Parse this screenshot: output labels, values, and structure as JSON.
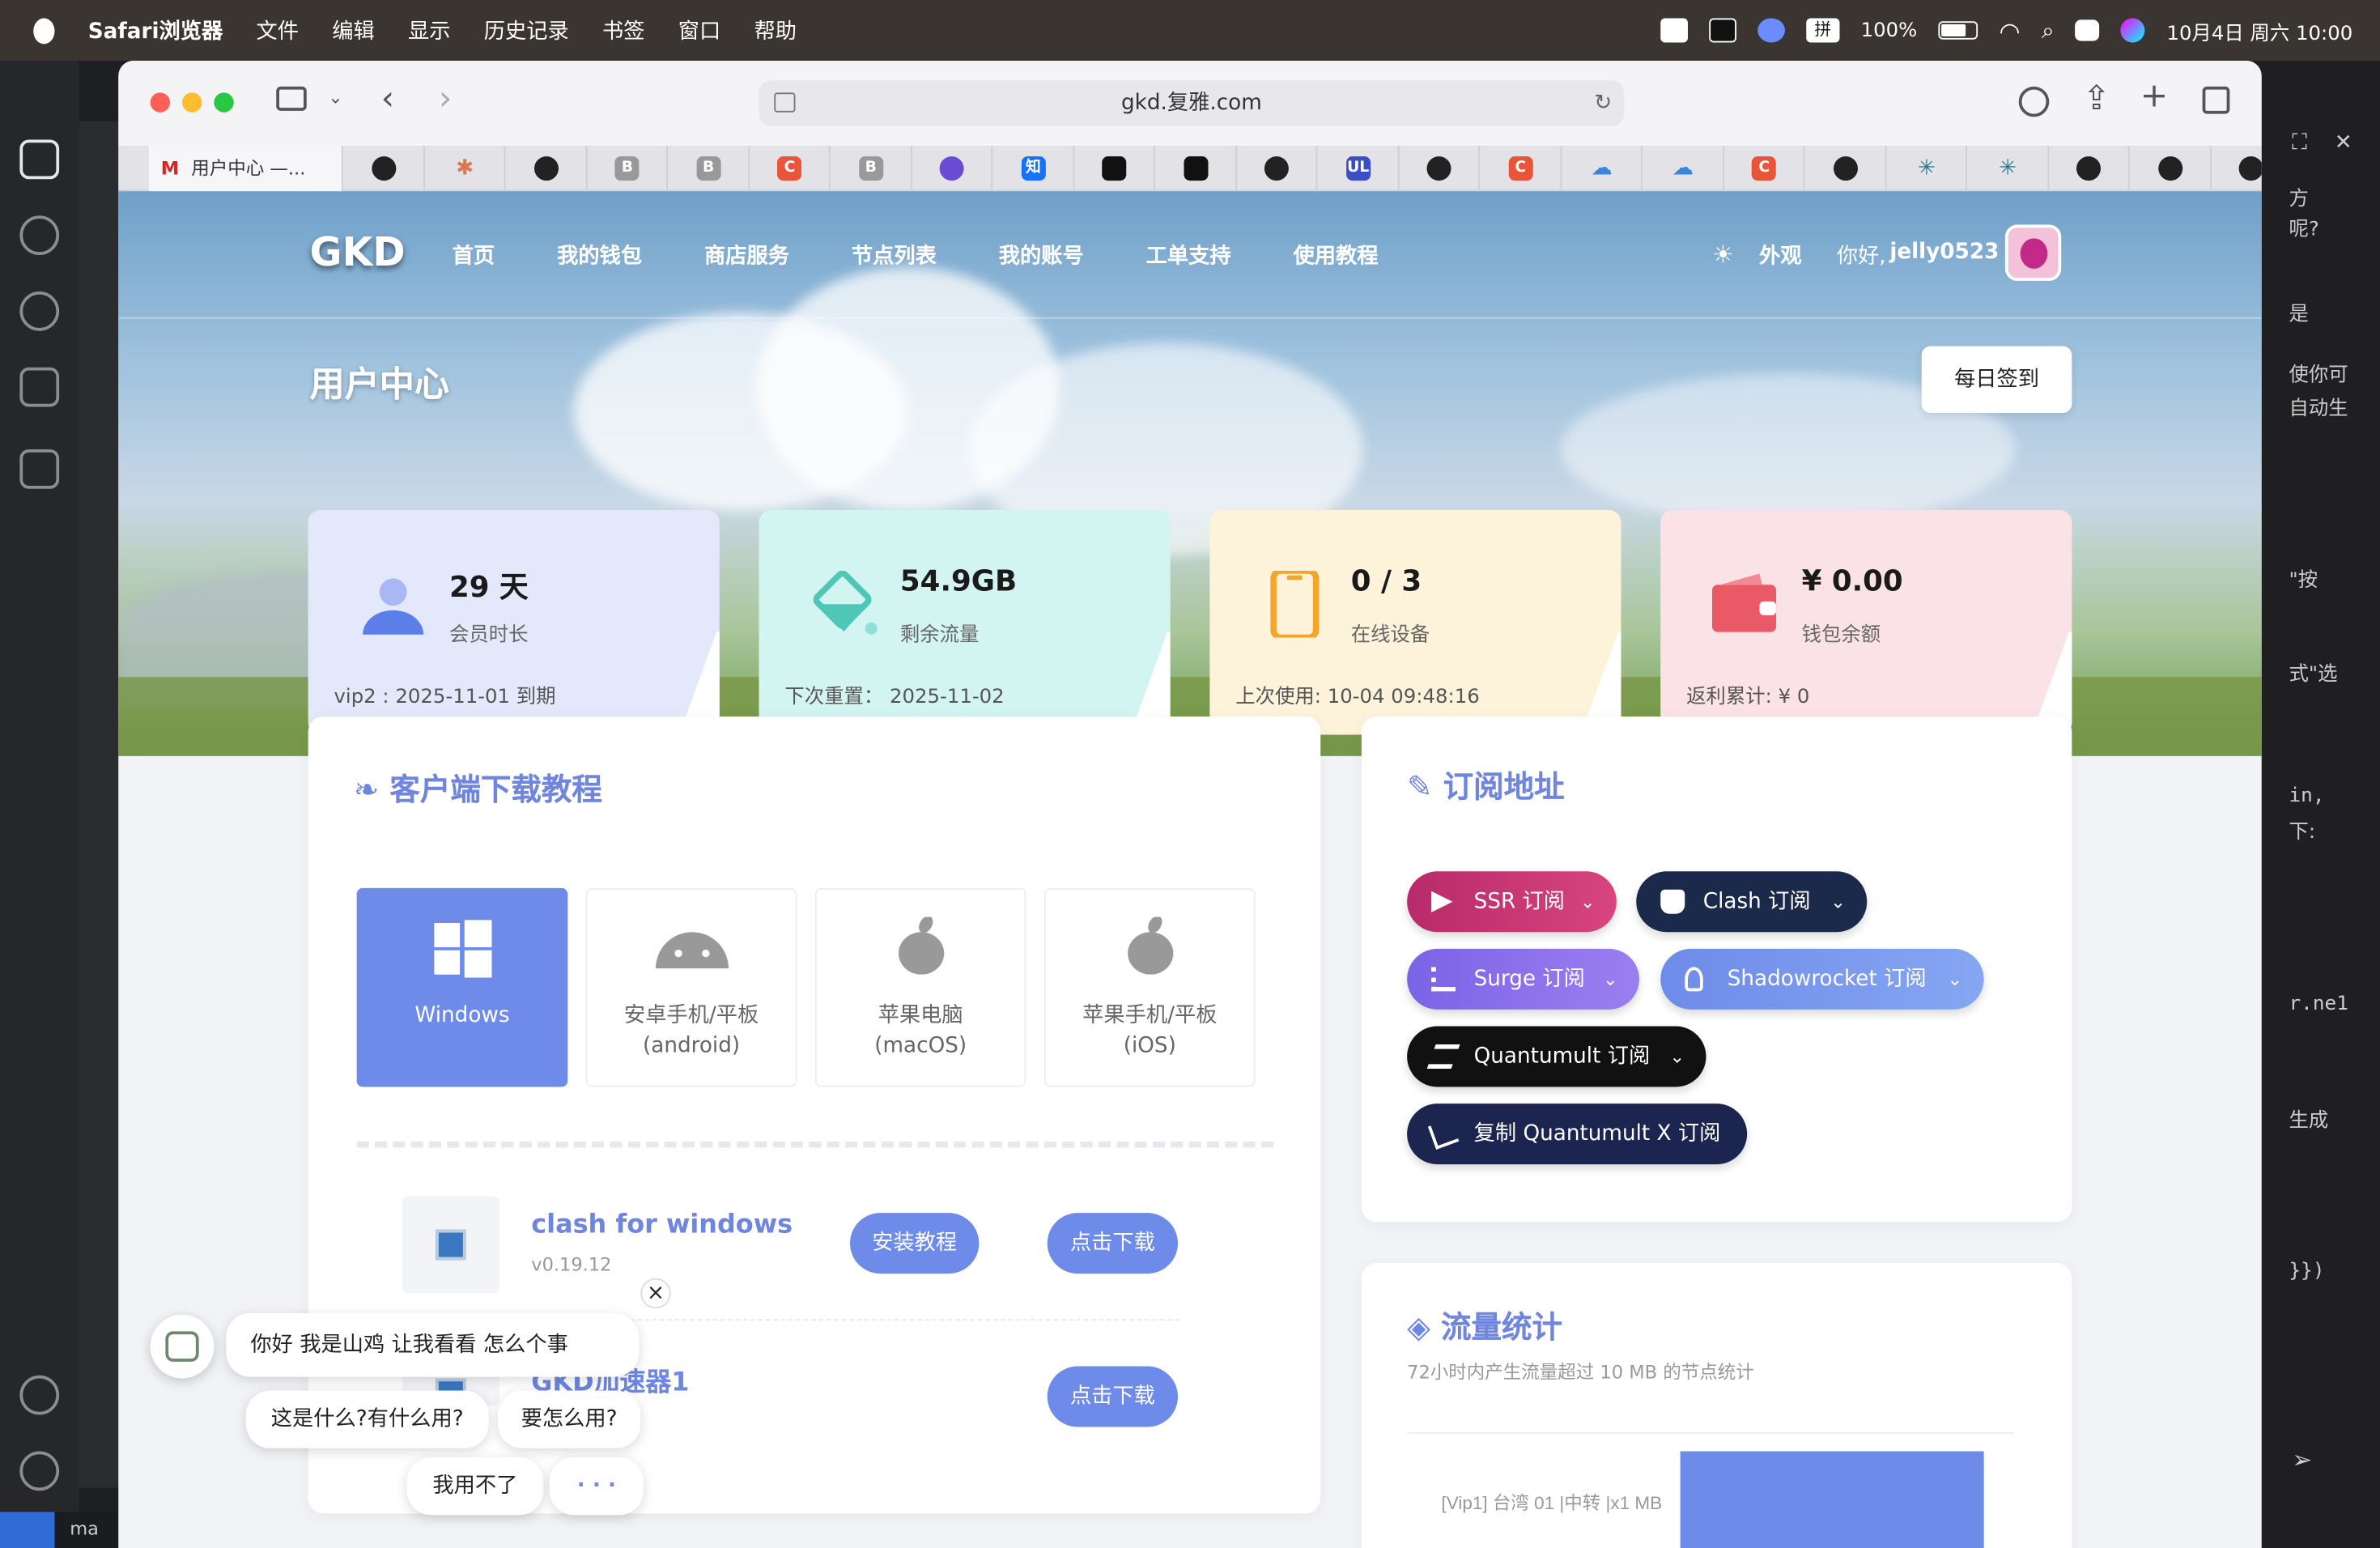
{
  "menubar": {
    "app": "Safari浏览器",
    "items": [
      "文件",
      "编辑",
      "显示",
      "历史记录",
      "书签",
      "窗口",
      "帮助"
    ],
    "input_badge": "拼",
    "battery": "100%",
    "datetime": "10月4日 周六 10:00"
  },
  "background_app": {
    "right_texts": [
      "方",
      "呢?",
      "是",
      "使你可",
      "自动生",
      "\"按",
      "式\"选",
      "in,",
      "下:",
      "r.ne1",
      "生成",
      "}})"
    ],
    "status_text": "ma"
  },
  "browser": {
    "url": "gkd.复雅.com",
    "active_tab": "用户中心 —...",
    "tab_favicons": [
      "github",
      "claude",
      "github",
      "B",
      "B",
      "C",
      "B",
      "github-purple",
      "知",
      "notion",
      "notion",
      "github",
      "UL",
      "github",
      "C",
      "cloud",
      "cloud",
      "C",
      "github",
      "perplexity",
      "perplexity",
      "github",
      "github",
      "github"
    ]
  },
  "nav": {
    "logo": "GKD",
    "items": [
      "首页",
      "我的钱包",
      "商店服务",
      "节点列表",
      "我的账号",
      "工单支持",
      "使用教程"
    ],
    "appearance": "外观",
    "greeting_prefix": "你好,",
    "username": "jelly0523"
  },
  "page": {
    "title": "用户中心",
    "checkin_button": "每日签到"
  },
  "stats": [
    {
      "value": "29 天",
      "label": "会员时长",
      "foot": "vip2 : 2025-11-01 到期",
      "color": "#e3e8fb"
    },
    {
      "value": "54.9GB",
      "label": "剩余流量",
      "foot": "下次重置： 2025-11-02",
      "color": "#d3f5f1"
    },
    {
      "value": "0 / 3",
      "label": "在线设备",
      "foot": "上次使用: 10-04 09:48:16",
      "color": "#fdf3da"
    },
    {
      "value": "¥ 0.00",
      "label": "钱包余额",
      "foot": "返利累计: ¥ 0",
      "color": "#fbe2e6"
    }
  ],
  "download": {
    "title": "客户端下载教程",
    "os_tabs": [
      {
        "line1": "Windows",
        "line2": "",
        "icon": "windows-icon",
        "selected": true
      },
      {
        "line1": "安卓手机/平板",
        "line2": "(android)",
        "icon": "android-icon",
        "selected": false
      },
      {
        "line1": "苹果电脑",
        "line2": "(macOS)",
        "icon": "apple-icon",
        "selected": false
      },
      {
        "line1": "苹果手机/平板",
        "line2": "(iOS)",
        "icon": "apple-icon",
        "selected": false
      }
    ],
    "apps": [
      {
        "name": "clash for windows",
        "version": "v0.19.12",
        "tutorial": "安装教程",
        "download": "点击下载"
      },
      {
        "name": "GKD加速器1",
        "version": "",
        "tutorial": "",
        "download": "点击下载"
      }
    ]
  },
  "subscribe": {
    "title": "订阅地址",
    "buttons": [
      {
        "label": "SSR 订阅",
        "color": "#c2306e"
      },
      {
        "label": "Clash 订阅",
        "color": "#1b2a4a"
      },
      {
        "label": "Surge 订阅",
        "color": "#8b6fe8"
      },
      {
        "label": "Shadowrocket 订阅",
        "color": "#6e8be9"
      },
      {
        "label": "Quantumult 订阅",
        "color": "#111111"
      },
      {
        "label": "复制 Quantumult X 订阅",
        "color": "#1c2550"
      }
    ]
  },
  "traffic": {
    "title": "流量统计",
    "subtitle": "72小时内产生流量超过 10 MB 的节点统计",
    "chart_data": {
      "type": "bar",
      "orientation": "horizontal",
      "categories": [
        "[Vip1] 台湾 01 |中转 |x1 MB"
      ],
      "values": [
        1
      ],
      "title": "",
      "xlabel": "",
      "ylabel": ""
    }
  },
  "chat": {
    "message": "你好 我是山鸡 让我看看 怎么个事",
    "close": "×",
    "options": [
      "这是什么?有什么用?",
      "要怎么用?",
      "我用不了",
      "· · ·"
    ]
  }
}
